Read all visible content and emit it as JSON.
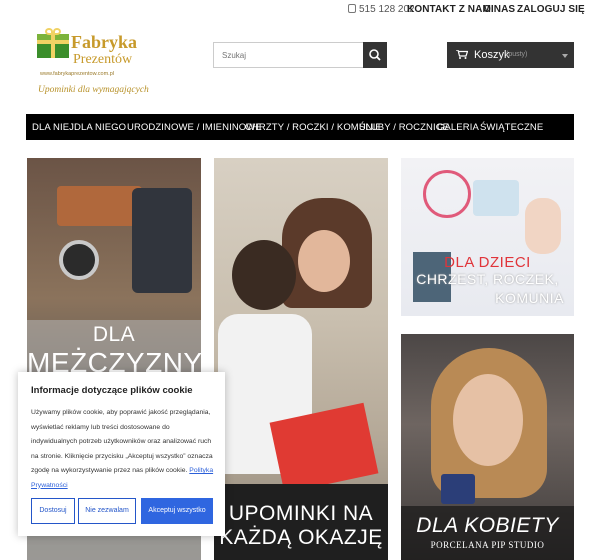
{
  "topbar": {
    "phone": "515 128 202",
    "links": [
      "KONTAKT Z NAMI",
      "O NAS",
      "ZALOGUJ SIĘ"
    ]
  },
  "logo": {
    "name_line1": "Fabryka",
    "name_line2": "Prezentów",
    "url": "www.fabrykaprezentow.com.pl",
    "tagline": "Upominki dla wymagających"
  },
  "search": {
    "placeholder": "Szukaj"
  },
  "cart": {
    "label": "Koszyk",
    "status": "(pusty)"
  },
  "nav": [
    "DLA NIEJ",
    "DLA NIEGO",
    "URODZINOWE / IMIENINOWE",
    "CHRZTY / ROCZKI / KOMUNIE",
    "ŚLUBY / ROCZNICE",
    "GALERIA",
    "ŚWIĄTECZNE"
  ],
  "tiles": {
    "men": {
      "line1": "DLA",
      "line2": "MĘŻCZYZNY"
    },
    "occasion": {
      "line1": "UPOMINKI NA",
      "line2": "KAŻDĄ OKAZJĘ"
    },
    "kids": {
      "line1": "DLA DZIECI",
      "line2": "CHRZEST, ROCZEK,",
      "line3": "KOMUNIA"
    },
    "women": {
      "line1": "DLA KOBIETY",
      "line2": "PORCELANA PIP STUDIO"
    }
  },
  "cookie": {
    "title": "Informacje dotyczące plików cookie",
    "text": "Używamy plików cookie, aby poprawić jakość przeglądania, wyświetlać reklamy lub treści dostosowane do indywidualnych potrzeb użytkowników oraz analizować ruch na stronie. Kliknięcie przycisku „Akceptuj wszystko” oznacza zgodę na wykorzystywanie przez nas plików cookie.",
    "policy_link": "Polityka Prywatności",
    "buttons": {
      "customize": "Dostosuj",
      "reject": "Nie zezwalam",
      "accept": "Akceptuj wszystko"
    }
  },
  "colors": {
    "accent": "#2f66e0",
    "nav_bg": "#000000",
    "logo_gold": "#c79a2b"
  }
}
